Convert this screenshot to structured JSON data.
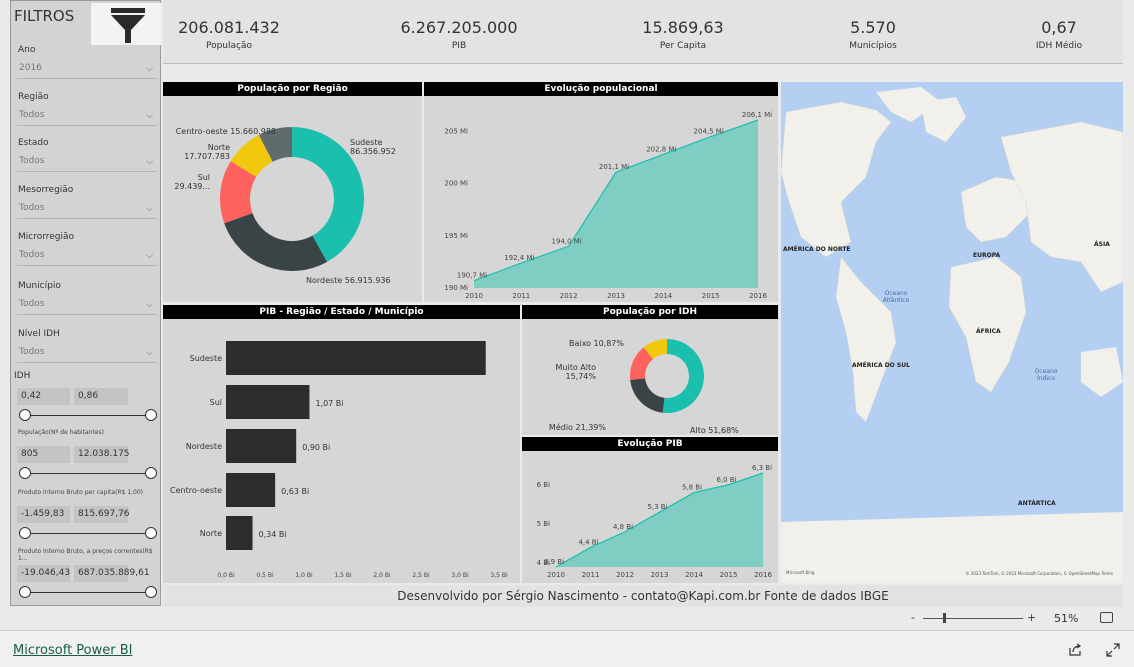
{
  "sidebar": {
    "title": "FILTROS",
    "filters": [
      {
        "label": "Ano",
        "value": "2016"
      },
      {
        "label": "Região",
        "value": "Todos"
      },
      {
        "label": "Estado",
        "value": "Todos"
      },
      {
        "label": "Mesorregião",
        "value": "Todos"
      },
      {
        "label": "Microrregião",
        "value": "Todos"
      },
      {
        "label": "Município",
        "value": "Todos"
      },
      {
        "label": "Nível IDH",
        "value": "Todos"
      }
    ],
    "ranges": [
      {
        "label": "IDH",
        "min": "0,42",
        "max": "0,86"
      },
      {
        "label": "População(Nº de habitantes)",
        "min": "805",
        "max": "12.038.175"
      },
      {
        "label": "Produto Interno Bruto per capita(R$ 1,00)",
        "min": "-1.459,83",
        "max": "815.697,76"
      },
      {
        "label": "Produto Interno Bruto, a preços correntes(R$ 1...",
        "min": "-19.046,43",
        "max": "687.035.889,61"
      }
    ]
  },
  "kpis": [
    {
      "value": "206.081.432",
      "label": "População"
    },
    {
      "value": "6.267.205.000",
      "label": "PIB"
    },
    {
      "value": "15.869,63",
      "label": "Per Capita"
    },
    {
      "value": "5.570",
      "label": "Municípios"
    },
    {
      "value": "0,67",
      "label": "IDH Médio"
    }
  ],
  "panels": {
    "pop_regiao": "População por Região",
    "evol_pop": "Evolução populacional",
    "pib_regiao": "PIB - Região / Estado / Município",
    "pop_idh": "População por IDH",
    "evol_pib": "Evolução PIB"
  },
  "map": {
    "labels": [
      "AMÉRICA DO NORTE",
      "EUROPA",
      "ÁSIA",
      "Oceano Atlântico",
      "ÁFRICA",
      "AMÉRICA DO SUL",
      "Oceano Índico",
      "ANTÁRTICA"
    ],
    "attribution": "© 2023 TomTom, © 2023 Microsoft Corporation, © OpenStreetMap  Terms",
    "bing": "Microsoft Bing"
  },
  "chart_data": [
    {
      "type": "pie",
      "title": "População por Região",
      "categories": [
        "Sudeste",
        "Nordeste",
        "Sul",
        "Norte",
        "Centro-oeste"
      ],
      "values": [
        86356952,
        56915936,
        29439000,
        17707783,
        15660988
      ],
      "labels": [
        "Sudeste\n86.356.952",
        "Nordeste 56.915.936",
        "Sul\n29.439...",
        "Norte\n17.707.783",
        "Centro-oeste 15.660.988"
      ],
      "colors": [
        "#1bbfae",
        "#3a4447",
        "#fd625e",
        "#f2c80f",
        "#5f6b6d"
      ]
    },
    {
      "type": "area",
      "title": "Evolução populacional",
      "x": [
        "2010",
        "2011",
        "2012",
        "2013",
        "2014",
        "2015",
        "2016"
      ],
      "values": [
        190.7,
        192.4,
        194.0,
        201.1,
        202.8,
        204.5,
        206.1
      ],
      "data_labels": [
        "190,7 Mi",
        "192,4 Mi",
        "194,0 Mi",
        "201,1 Mi",
        "202,8 Mi",
        "204,5 Mi",
        "206,1 Mi"
      ],
      "yticks": [
        "190 Mi",
        "195 Mi",
        "200 Mi",
        "205 Mi"
      ],
      "ylim": [
        190,
        206.1
      ]
    },
    {
      "type": "bar",
      "title": "PIB - Região / Estado / Município",
      "categories": [
        "Sudeste",
        "Sul",
        "Nordeste",
        "Centro-oeste",
        "Norte"
      ],
      "values": [
        3.33,
        1.07,
        0.9,
        0.63,
        0.34
      ],
      "data_labels": [
        "3,33 Bi",
        "1,07 Bi",
        "0,90 Bi",
        "0,63 Bi",
        "0,34 Bi"
      ],
      "xticks": [
        "0,0 Bi",
        "0,5 Bi",
        "1,0 Bi",
        "1,5 Bi",
        "2,0 Bi",
        "2,5 Bi",
        "3,0 Bi",
        "3,5 Bi"
      ],
      "xlim": [
        0,
        3.5
      ]
    },
    {
      "type": "pie",
      "title": "População por IDH",
      "categories": [
        "Alto",
        "Médio",
        "Muito Alto",
        "Baixo"
      ],
      "values": [
        51.68,
        21.39,
        15.74,
        10.87
      ],
      "labels": [
        "Alto 51,68%",
        "Médio 21,39%",
        "Muito Alto\n15,74%",
        "Baixo 10,87%"
      ],
      "colors": [
        "#1bbfae",
        "#3a4447",
        "#fd625e",
        "#f2c80f"
      ]
    },
    {
      "type": "area",
      "title": "Evolução PIB",
      "x": [
        "2010",
        "2011",
        "2012",
        "2013",
        "2014",
        "2015",
        "2016"
      ],
      "values": [
        3.9,
        4.4,
        4.8,
        5.3,
        5.8,
        6.0,
        6.3
      ],
      "data_labels": [
        "3,9 Bi",
        "4,4 Bi",
        "4,8 Bi",
        "5,3 Bi",
        "5,8 Bi",
        "6,0 Bi",
        "6,3 Bi"
      ],
      "yticks": [
        "4 Bi",
        "5 Bi",
        "6 Bi"
      ],
      "ylim": [
        3.9,
        6.3
      ]
    }
  ],
  "footer": {
    "credit": "Desenvolvido por Sérgio Nascimento - contato@Kapi.com.br  Fonte de dados IBGE"
  },
  "zoom": {
    "minus": "-",
    "plus": "+",
    "value": "51%"
  },
  "bottombar": {
    "link": "Microsoft Power BI"
  },
  "theme": {
    "teal": "#1bbfae",
    "dark": "#3a4447",
    "red": "#fd625e",
    "yellow": "#f2c80f",
    "slate": "#5f6b6d"
  }
}
